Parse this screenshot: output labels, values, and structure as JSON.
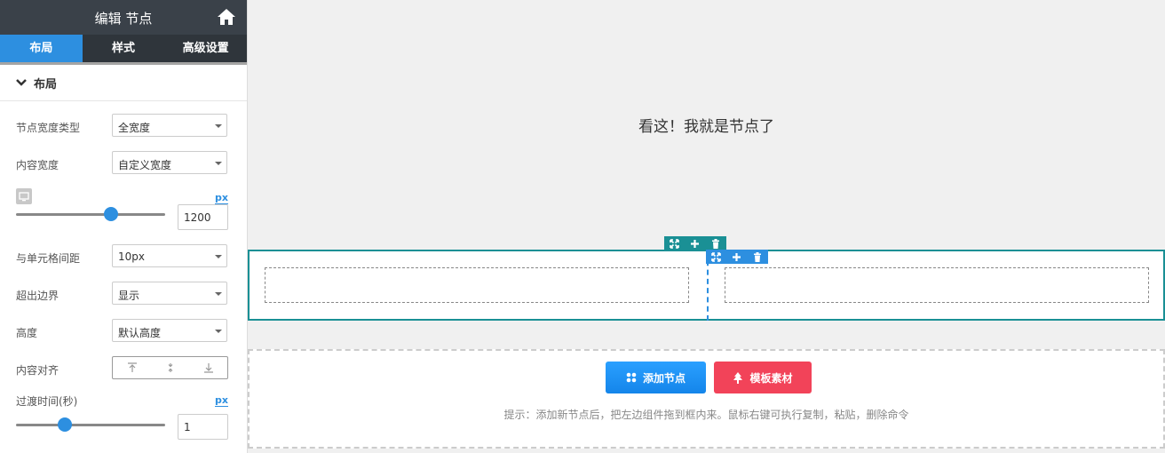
{
  "sidebar": {
    "title": "编辑 节点",
    "tabs": [
      "布局",
      "样式",
      "高级设置"
    ],
    "section_title": "布局",
    "fields": {
      "width_type": {
        "label": "节点宽度类型",
        "value": "全宽度"
      },
      "content_width": {
        "label": "内容宽度",
        "value": "自定义宽度"
      },
      "content_width_value": {
        "unit": "px",
        "value": "1200",
        "slider_fraction": 0.63
      },
      "cell_gap": {
        "label": "与单元格间距",
        "value": "10px"
      },
      "overflow": {
        "label": "超出边界",
        "value": "显示"
      },
      "height": {
        "label": "高度",
        "value": "默认高度"
      },
      "content_align": {
        "label": "内容对齐"
      },
      "transition": {
        "label": "过渡时间(秒)",
        "unit": "px",
        "value": "1",
        "slider_fraction": 0.33
      }
    }
  },
  "canvas": {
    "hero_text": "看这！我就是节点了",
    "add_node_label": "添加节点",
    "template_label": "模板素材",
    "hint": "提示：添加新节点后，把左边组件拖到框内来。鼠标右键可执行复制，粘贴，删除命令"
  },
  "colors": {
    "accent": "#2d8fe0",
    "teal": "#1a9095",
    "red": "#f24359",
    "header": "#3a4149"
  }
}
